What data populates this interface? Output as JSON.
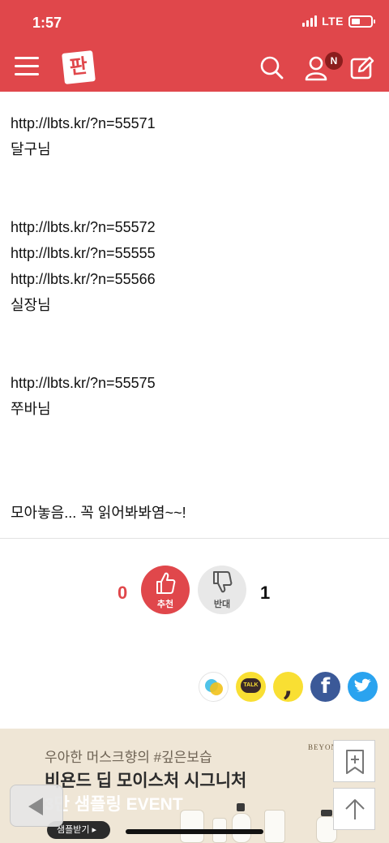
{
  "status_bar": {
    "time": "1:57",
    "network": "LTE",
    "battery_level": 0.45
  },
  "nav": {
    "logo_text": "판",
    "notification_badge": "N",
    "icons": [
      "menu-icon",
      "search-icon",
      "user-icon",
      "edit-icon"
    ]
  },
  "post": {
    "blocks": [
      {
        "lines": [
          "http://lbts.kr/?n=55571",
          "달구님"
        ]
      },
      {
        "lines": [
          "http://lbts.kr/?n=55572",
          "http://lbts.kr/?n=55555",
          "http://lbts.kr/?n=55566",
          "실장님"
        ]
      },
      {
        "lines": [
          "http://lbts.kr/?n=55575",
          "쭈바님"
        ]
      },
      {
        "lines": [
          "모아놓음... 꼭 읽어봐봐염~~!"
        ]
      }
    ]
  },
  "vote": {
    "up_count": "0",
    "up_label": "추천",
    "down_label": "반대",
    "down_count": "1"
  },
  "share": {
    "talk_label": "TALK",
    "icons": [
      "kakaostory-icon",
      "kakaotalk-icon",
      "kakao-comma-icon",
      "facebook-icon",
      "twitter-icon"
    ]
  },
  "ad": {
    "brand": "BEYOND",
    "subtitle": "우아한 머스크향의 #깊은보습",
    "title": "비욘드 딥 모이스처 시그니처",
    "event": "3만 샘플링 EVENT",
    "cta": "샘플받기 ▸"
  },
  "colors": {
    "brand_red": "#e0474b",
    "facebook": "#3b5998",
    "twitter": "#2aa3ef",
    "kakao_yellow": "#f9df33"
  }
}
